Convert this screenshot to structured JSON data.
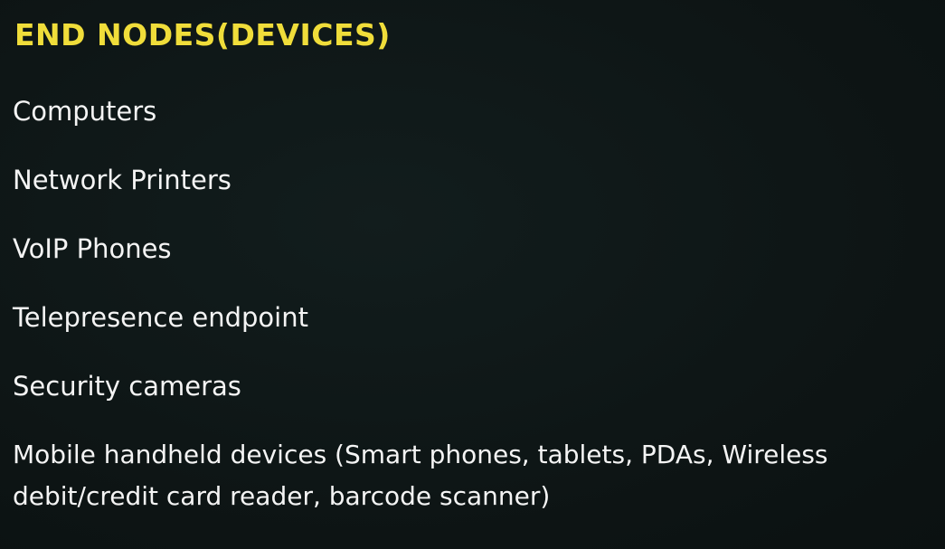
{
  "slide": {
    "title": "End nodes(devices)",
    "items": [
      "Computers",
      "Network Printers",
      "VoIP Phones",
      "Telepresence endpoint",
      "Security cameras",
      "Mobile handheld  devices (Smart phones, tablets, PDAs, Wireless debit/credit card reader, barcode scanner)"
    ]
  },
  "colors": {
    "background": "#0e1616",
    "title": "#f0dd3a",
    "text": "#f4f4f4"
  }
}
